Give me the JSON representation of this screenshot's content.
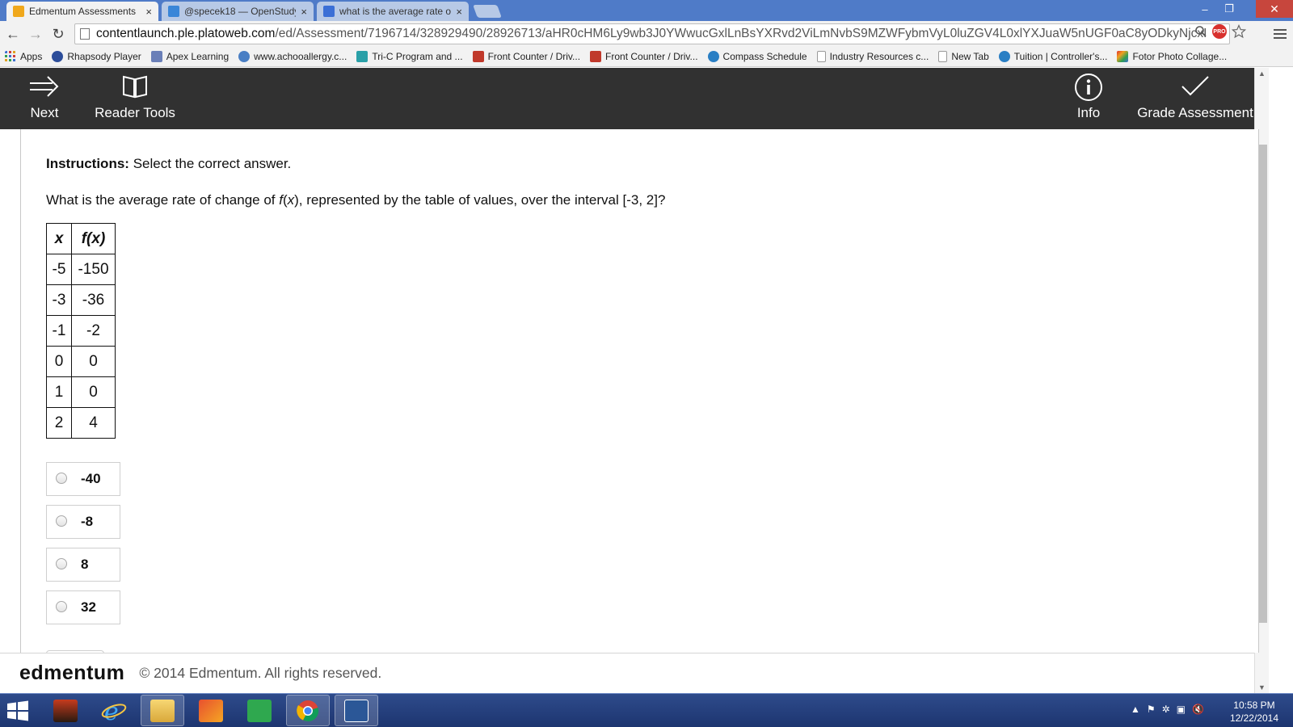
{
  "browser": {
    "tabs": [
      {
        "title": "Edmentum Assessments",
        "close": "×",
        "active": true,
        "favicon_color": "#f0a81c"
      },
      {
        "title": "@specek18 — OpenStudy",
        "close": "×",
        "active": false,
        "favicon_color": "#3a86d8"
      },
      {
        "title": "what is the average rate of",
        "close": "×",
        "active": false,
        "favicon_color": "#3b6fd6"
      }
    ],
    "window_controls": {
      "minimize": "–",
      "restore": "❐",
      "close": "✕"
    },
    "nav": {
      "back": "←",
      "forward": "→",
      "reload": "↻"
    },
    "url": {
      "host": "contentlaunch.ple.platoweb.com",
      "path": "/ed/Assessment/7196714/328929490/28926713/aHR0cHM6Ly9wb3J0YWwucGxlLnBsYXRvd2ViLmNvbS9MZWFybmVyL0luZGV4L0xlYXJuaW5nUGF0aC8yODkyNjcxI"
    },
    "pro_badge": "PRO",
    "bookmarks": [
      {
        "label": "Apps",
        "color": "#3d6fd0"
      },
      {
        "label": "Rhapsody Player",
        "color": "#2c4d9a"
      },
      {
        "label": "Apex Learning",
        "color": "#6a7fb8"
      },
      {
        "label": "www.achooallergy.c...",
        "color": "#4a7fc4"
      },
      {
        "label": "Tri-C Program and ...",
        "color": "#2aa0a8"
      },
      {
        "label": "Front Counter / Driv...",
        "color": "#c0392b"
      },
      {
        "label": "Front Counter / Driv...",
        "color": "#c0392b"
      },
      {
        "label": "Compass Schedule",
        "color": "#2a7fc4"
      },
      {
        "label": "Industry Resources c...",
        "color": "#bdbdbd"
      },
      {
        "label": "New Tab",
        "color": "#bdbdbd"
      },
      {
        "label": "Tuition | Controller's...",
        "color": "#2a7fc4"
      },
      {
        "label": "Fotor Photo Collage...",
        "color": "#e07b20"
      }
    ]
  },
  "app": {
    "next_label": "Next",
    "reader_tools_label": "Reader Tools",
    "info_label": "Info",
    "grade_label": "Grade Assessment"
  },
  "question": {
    "instructions_label": "Instructions:",
    "instructions_text": "Select the correct answer.",
    "prompt_before": "What is the average rate of change of ",
    "prompt_func": "f",
    "prompt_paren_open": "(",
    "prompt_var": "x",
    "prompt_after": "), represented by the table of values, over the interval [-3, 2]?",
    "table": {
      "headers": [
        "x",
        "f(x)"
      ],
      "rows": [
        [
          "-5",
          "-150"
        ],
        [
          "-3",
          "-36"
        ],
        [
          "-1",
          "-2"
        ],
        [
          "0",
          "0"
        ],
        [
          "1",
          "0"
        ],
        [
          "2",
          "4"
        ]
      ]
    },
    "choices": [
      "-40",
      "-8",
      "8",
      "32"
    ]
  },
  "footer": {
    "logo": "edmentum",
    "copyright": "© 2014 Edmentum. All rights reserved."
  },
  "taskbar": {
    "time": "10:58 PM",
    "date": "12/22/2014"
  }
}
